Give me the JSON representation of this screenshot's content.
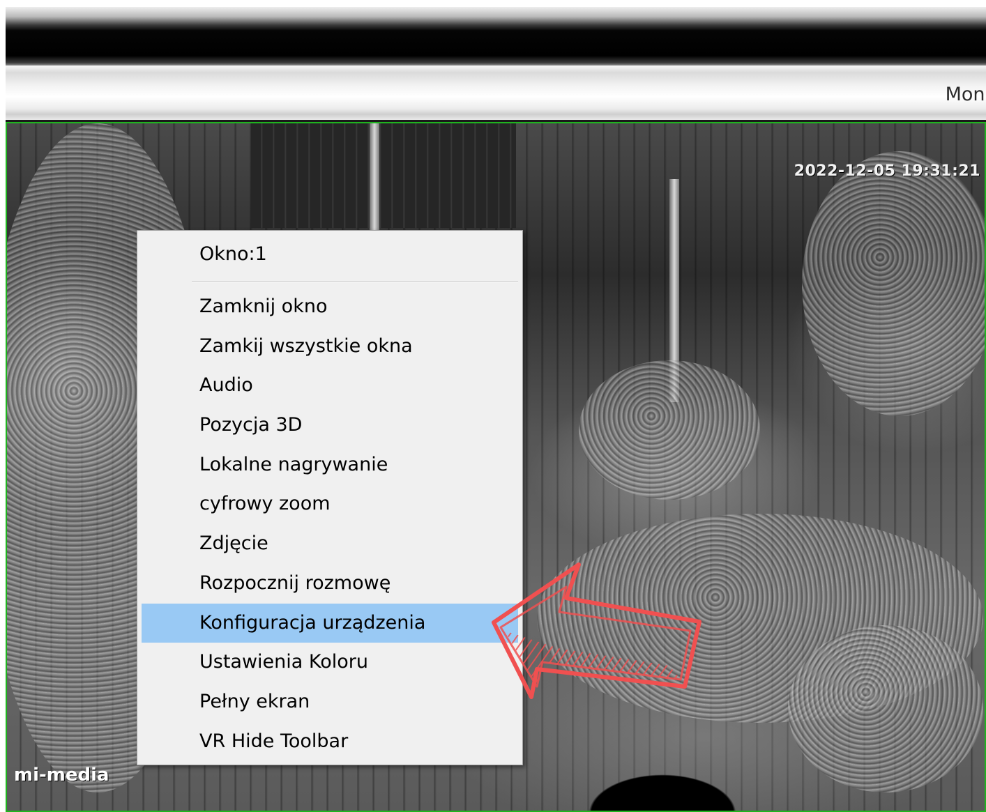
{
  "toolbar": {
    "tab_label": "Moni"
  },
  "video": {
    "timestamp": "2022-12-05 19:31:21",
    "watermark": "mi-media",
    "border_color": "#1fb41f"
  },
  "context_menu": {
    "title": "Okno:1",
    "items": [
      {
        "label": "Zamknij okno"
      },
      {
        "label": "Zamkij wszystkie okna"
      },
      {
        "label": "Audio"
      },
      {
        "label": "Pozycja 3D"
      },
      {
        "label": "Lokalne nagrywanie"
      },
      {
        "label": "cyfrowy zoom"
      },
      {
        "label": "Zdjęcie"
      },
      {
        "label": "Rozpocznij rozmowę"
      },
      {
        "label": "Konfiguracja urządzenia"
      },
      {
        "label": "Ustawienia Koloru"
      },
      {
        "label": "Pełny ekran"
      },
      {
        "label": "VR Hide Toolbar"
      }
    ],
    "highlighted_item": "Konfiguracja urządzenia",
    "highlight_color": "#99c9f4"
  },
  "annotation": {
    "icon": "red-arrow-icon",
    "color": "#f05050"
  }
}
